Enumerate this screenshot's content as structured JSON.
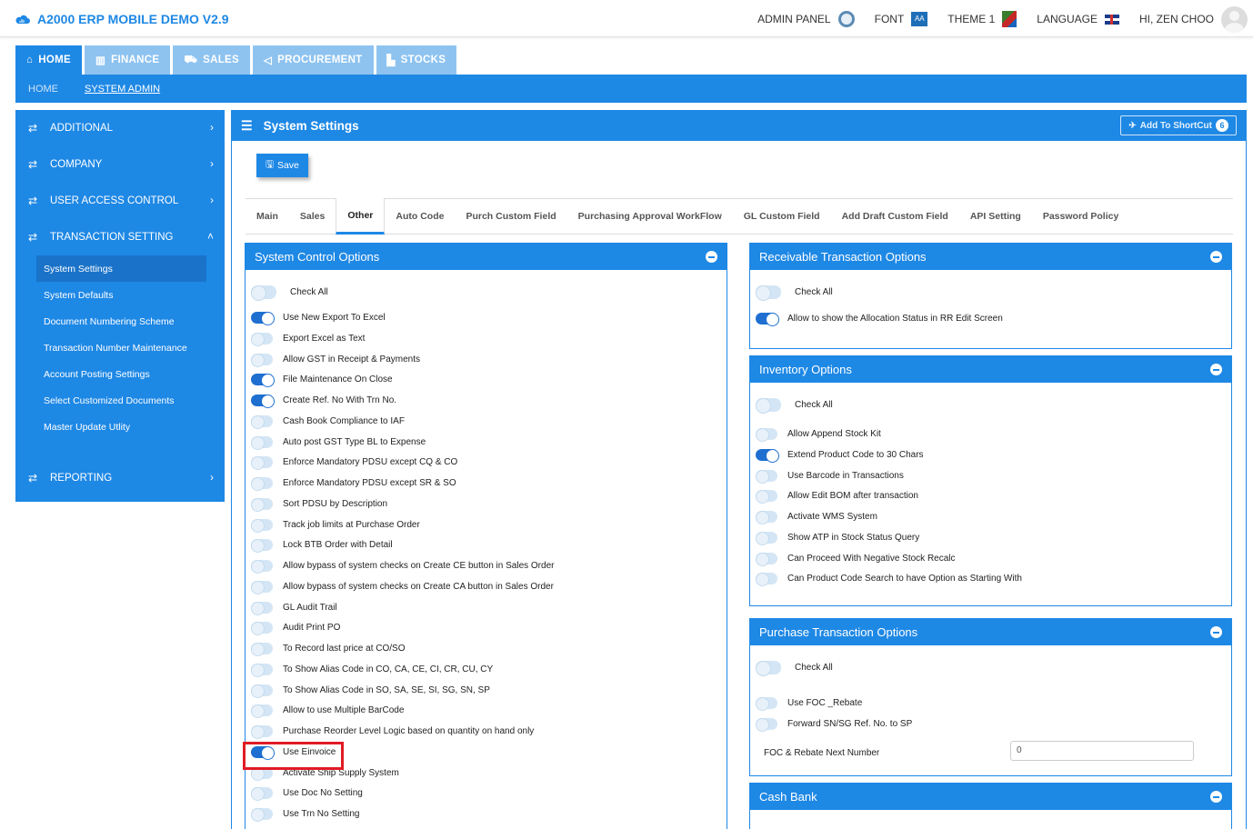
{
  "app": {
    "title": "A2000 ERP MOBILE DEMO V2.9"
  },
  "topbar": {
    "admin_panel": "ADMIN PANEL",
    "font": "FONT",
    "font_icon_text": "AA",
    "theme": "THEME 1",
    "language": "LANGUAGE",
    "user": "HI, ZEN CHOO"
  },
  "menu": [
    {
      "label": "HOME",
      "icon": "home-icon",
      "glyph": "⌂"
    },
    {
      "label": "FINANCE",
      "icon": "bank-icon",
      "glyph": "▥"
    },
    {
      "label": "SALES",
      "icon": "cart-icon",
      "glyph": "⛟"
    },
    {
      "label": "PROCUREMENT",
      "icon": "bullhorn-icon",
      "glyph": "◁"
    },
    {
      "label": "STOCKS",
      "icon": "bar-chart-icon",
      "glyph": "▙"
    }
  ],
  "breadcrumb": {
    "home": "HOME",
    "current": "SYSTEM ADMIN"
  },
  "sidebar": {
    "groups": [
      {
        "label": "ADDITIONAL"
      },
      {
        "label": "COMPANY"
      },
      {
        "label": "USER ACCESS CONTROL"
      },
      {
        "label": "TRANSACTION SETTING"
      },
      {
        "label": "REPORTING"
      }
    ],
    "items": [
      "System Settings",
      "System Defaults",
      "Document Numbering Scheme",
      "Transaction Number Maintenance",
      "Account Posting Settings",
      "Select Customized Documents",
      "Master Update Utlity"
    ]
  },
  "panel": {
    "title": "System Settings",
    "shortcut": "Add To ShortCut",
    "shortcut_count": "6",
    "save": "Save"
  },
  "tabs": [
    "Main",
    "Sales",
    "Other",
    "Auto Code",
    "Purch Custom Field",
    "Purchasing Approval WorkFlow",
    "GL Custom Field",
    "Add Draft Custom Field",
    "API Setting",
    "Password Policy"
  ],
  "system_control": {
    "title": "System Control Options",
    "check_all": "Check All",
    "options": [
      {
        "label": "Use New Export To Excel",
        "on": true
      },
      {
        "label": "Export Excel as Text",
        "on": false
      },
      {
        "label": "Allow GST in Receipt & Payments",
        "on": false
      },
      {
        "label": "File Maintenance On Close",
        "on": true
      },
      {
        "label": "Create Ref. No With Trn No.",
        "on": true
      },
      {
        "label": "Cash Book Compliance to IAF",
        "on": false
      },
      {
        "label": "Auto post GST Type BL to Expense",
        "on": false
      },
      {
        "label": "Enforce Mandatory PDSU except CQ & CO",
        "on": false
      },
      {
        "label": "Enforce Mandatory PDSU except SR & SO",
        "on": false
      },
      {
        "label": "Sort PDSU by Description",
        "on": false
      },
      {
        "label": "Track job limits at Purchase Order",
        "on": false
      },
      {
        "label": "Lock BTB Order with Detail",
        "on": false
      },
      {
        "label": "Allow bypass of system checks on Create CE button in Sales Order",
        "on": false
      },
      {
        "label": "Allow bypass of system checks on Create CA button in Sales Order",
        "on": false
      },
      {
        "label": "GL Audit Trail",
        "on": false
      },
      {
        "label": "Audit Print PO",
        "on": false
      },
      {
        "label": "To Record last price at CO/SO",
        "on": false
      },
      {
        "label": "To Show Alias Code in CO, CA, CE, CI, CR, CU, CY",
        "on": false
      },
      {
        "label": "To Show Alias Code in SO, SA, SE, SI, SG, SN, SP",
        "on": false
      },
      {
        "label": "Allow to use Multiple BarCode",
        "on": false
      },
      {
        "label": "Purchase Reorder Level Logic based on quantity on hand only",
        "on": false
      },
      {
        "label": "Use Einvoice",
        "on": true
      },
      {
        "label": "Activate Ship Supply System",
        "on": false
      },
      {
        "label": "Use Doc No Setting",
        "on": false
      },
      {
        "label": "Use Trn No Setting",
        "on": false
      }
    ]
  },
  "receivable": {
    "title": "Receivable Transaction Options",
    "check_all": "Check All",
    "options": [
      {
        "label": "Allow to show the Allocation Status in RR Edit Screen",
        "on": true
      }
    ]
  },
  "inventory": {
    "title": "Inventory Options",
    "check_all": "Check All",
    "options": [
      {
        "label": "Allow Append Stock Kit",
        "on": false
      },
      {
        "label": "Extend Product Code to 30 Chars",
        "on": true
      },
      {
        "label": "Use Barcode in Transactions",
        "on": false
      },
      {
        "label": "Allow Edit BOM after transaction",
        "on": false
      },
      {
        "label": "Activate WMS System",
        "on": false
      },
      {
        "label": "Show ATP in Stock Status Query",
        "on": false
      },
      {
        "label": "Can Proceed With Negative Stock Recalc",
        "on": false
      },
      {
        "label": "Can Product Code Search to have Option as Starting With",
        "on": false
      }
    ]
  },
  "purchase": {
    "title": "Purchase Transaction Options",
    "check_all": "Check All",
    "options": [
      {
        "label": "Use FOC _Rebate",
        "on": false
      },
      {
        "label": "Forward SN/SG Ref. No. to SP",
        "on": false
      }
    ],
    "foc_label": "FOC & Rebate Next Number",
    "foc_value": "0"
  },
  "cash_bank": {
    "title": "Cash Bank"
  }
}
